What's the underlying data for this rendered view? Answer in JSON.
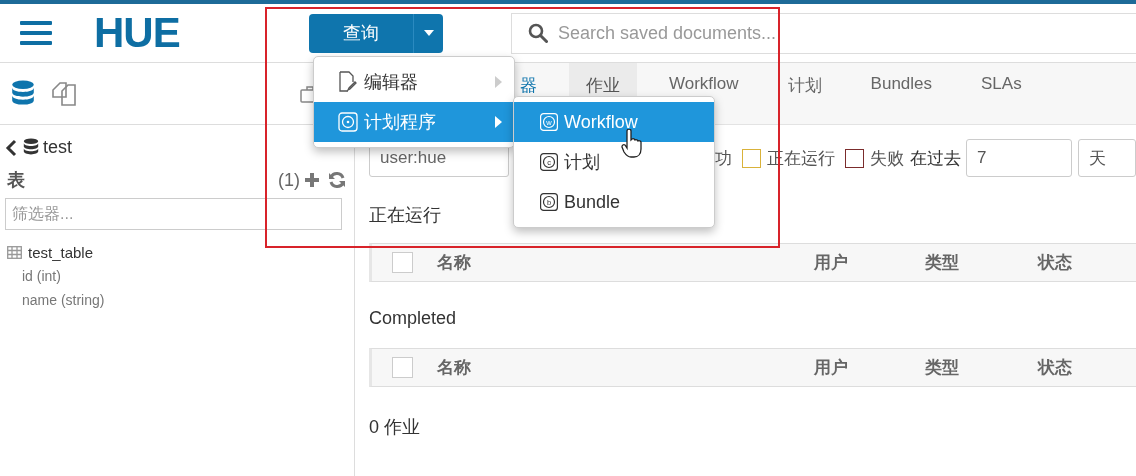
{
  "header": {
    "logo": "HUE",
    "query_button": "查询",
    "search": {
      "placeholder": "Search saved documents..."
    }
  },
  "sidebar": {
    "database": "test",
    "section": "表",
    "count": "(1)",
    "filter": {
      "placeholder": "筛选器..."
    },
    "tree": [
      {
        "label": "test_table",
        "children": [
          {
            "label": "id (int)"
          },
          {
            "label": "name (string)"
          }
        ]
      }
    ]
  },
  "tabs": [
    {
      "label": "器",
      "selected": false
    },
    {
      "label": "作业",
      "selected": true
    },
    {
      "label": "Workflow",
      "selected": false
    },
    {
      "label": "计划",
      "selected": false
    },
    {
      "label": "Bundles",
      "selected": false
    },
    {
      "label": "SLAs",
      "selected": false
    }
  ],
  "filters": {
    "user": {
      "value": "user:hue"
    },
    "hidden_status_label": "功",
    "statuses": [
      {
        "label": "正在运行",
        "color": "#d9b23a"
      },
      {
        "label": "失败",
        "color": "#7b2c2c"
      }
    ],
    "period_label": "在过去",
    "period_value": "7",
    "period_unit": "天"
  },
  "sections": [
    {
      "title": "正在运行",
      "checked": false,
      "columns": [
        "名称",
        "用户",
        "类型",
        "状态"
      ]
    },
    {
      "title": "Completed",
      "checked": false,
      "columns": [
        "名称",
        "用户",
        "类型",
        "状态"
      ]
    }
  ],
  "job_count": "0 作业",
  "menu": {
    "items": [
      {
        "label": "编辑器",
        "kind": "editor",
        "selected": false
      },
      {
        "label": "计划程序",
        "kind": "scheduler",
        "selected": true
      }
    ]
  },
  "submenu": {
    "items": [
      {
        "label": "Workflow",
        "glyph": "w",
        "selected": true
      },
      {
        "label": "计划",
        "glyph": "c",
        "selected": false
      },
      {
        "label": "Bundle",
        "glyph": "b",
        "selected": false
      }
    ]
  }
}
